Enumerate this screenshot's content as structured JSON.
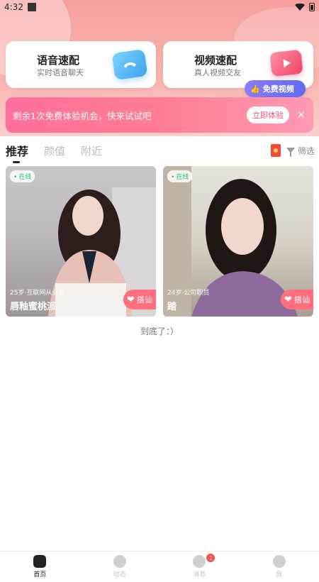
{
  "status_bar": {
    "time": "4:32"
  },
  "quick_match": [
    {
      "title": "语音速配",
      "subtitle": "实时语音聊天"
    },
    {
      "title": "视频速配",
      "subtitle": "真人视频交友"
    }
  ],
  "free_video_badge": "免费视频",
  "promo": {
    "text": "剩余1次免费体验机会，快来试试吧",
    "button": "立即体验",
    "close": "×"
  },
  "tabs": {
    "items": [
      "推荐",
      "颜值",
      "附近"
    ],
    "active_index": 0,
    "filter_label": "筛选"
  },
  "profiles": [
    {
      "online_label": "在线",
      "meta": "25岁·互联网从业者",
      "nickname": "唇釉蜜桃派",
      "action": "搭讪"
    },
    {
      "online_label": "在线",
      "meta": "24岁·公司职员",
      "nickname": "踏",
      "action": "搭讪"
    }
  ],
  "end_text": "到底了：）",
  "bottom_nav": {
    "items": [
      {
        "label": "首页",
        "icon": "home-icon",
        "active": true
      },
      {
        "label": "动态",
        "icon": "compass-icon",
        "active": false
      },
      {
        "label": "消息",
        "icon": "message-icon",
        "active": false,
        "badge": "1"
      },
      {
        "label": "我",
        "icon": "profile-face-icon",
        "active": false
      }
    ]
  },
  "colors": {
    "accent": "#ff6f7d",
    "promo": "#ff7d93",
    "online": "#2ac26b"
  }
}
